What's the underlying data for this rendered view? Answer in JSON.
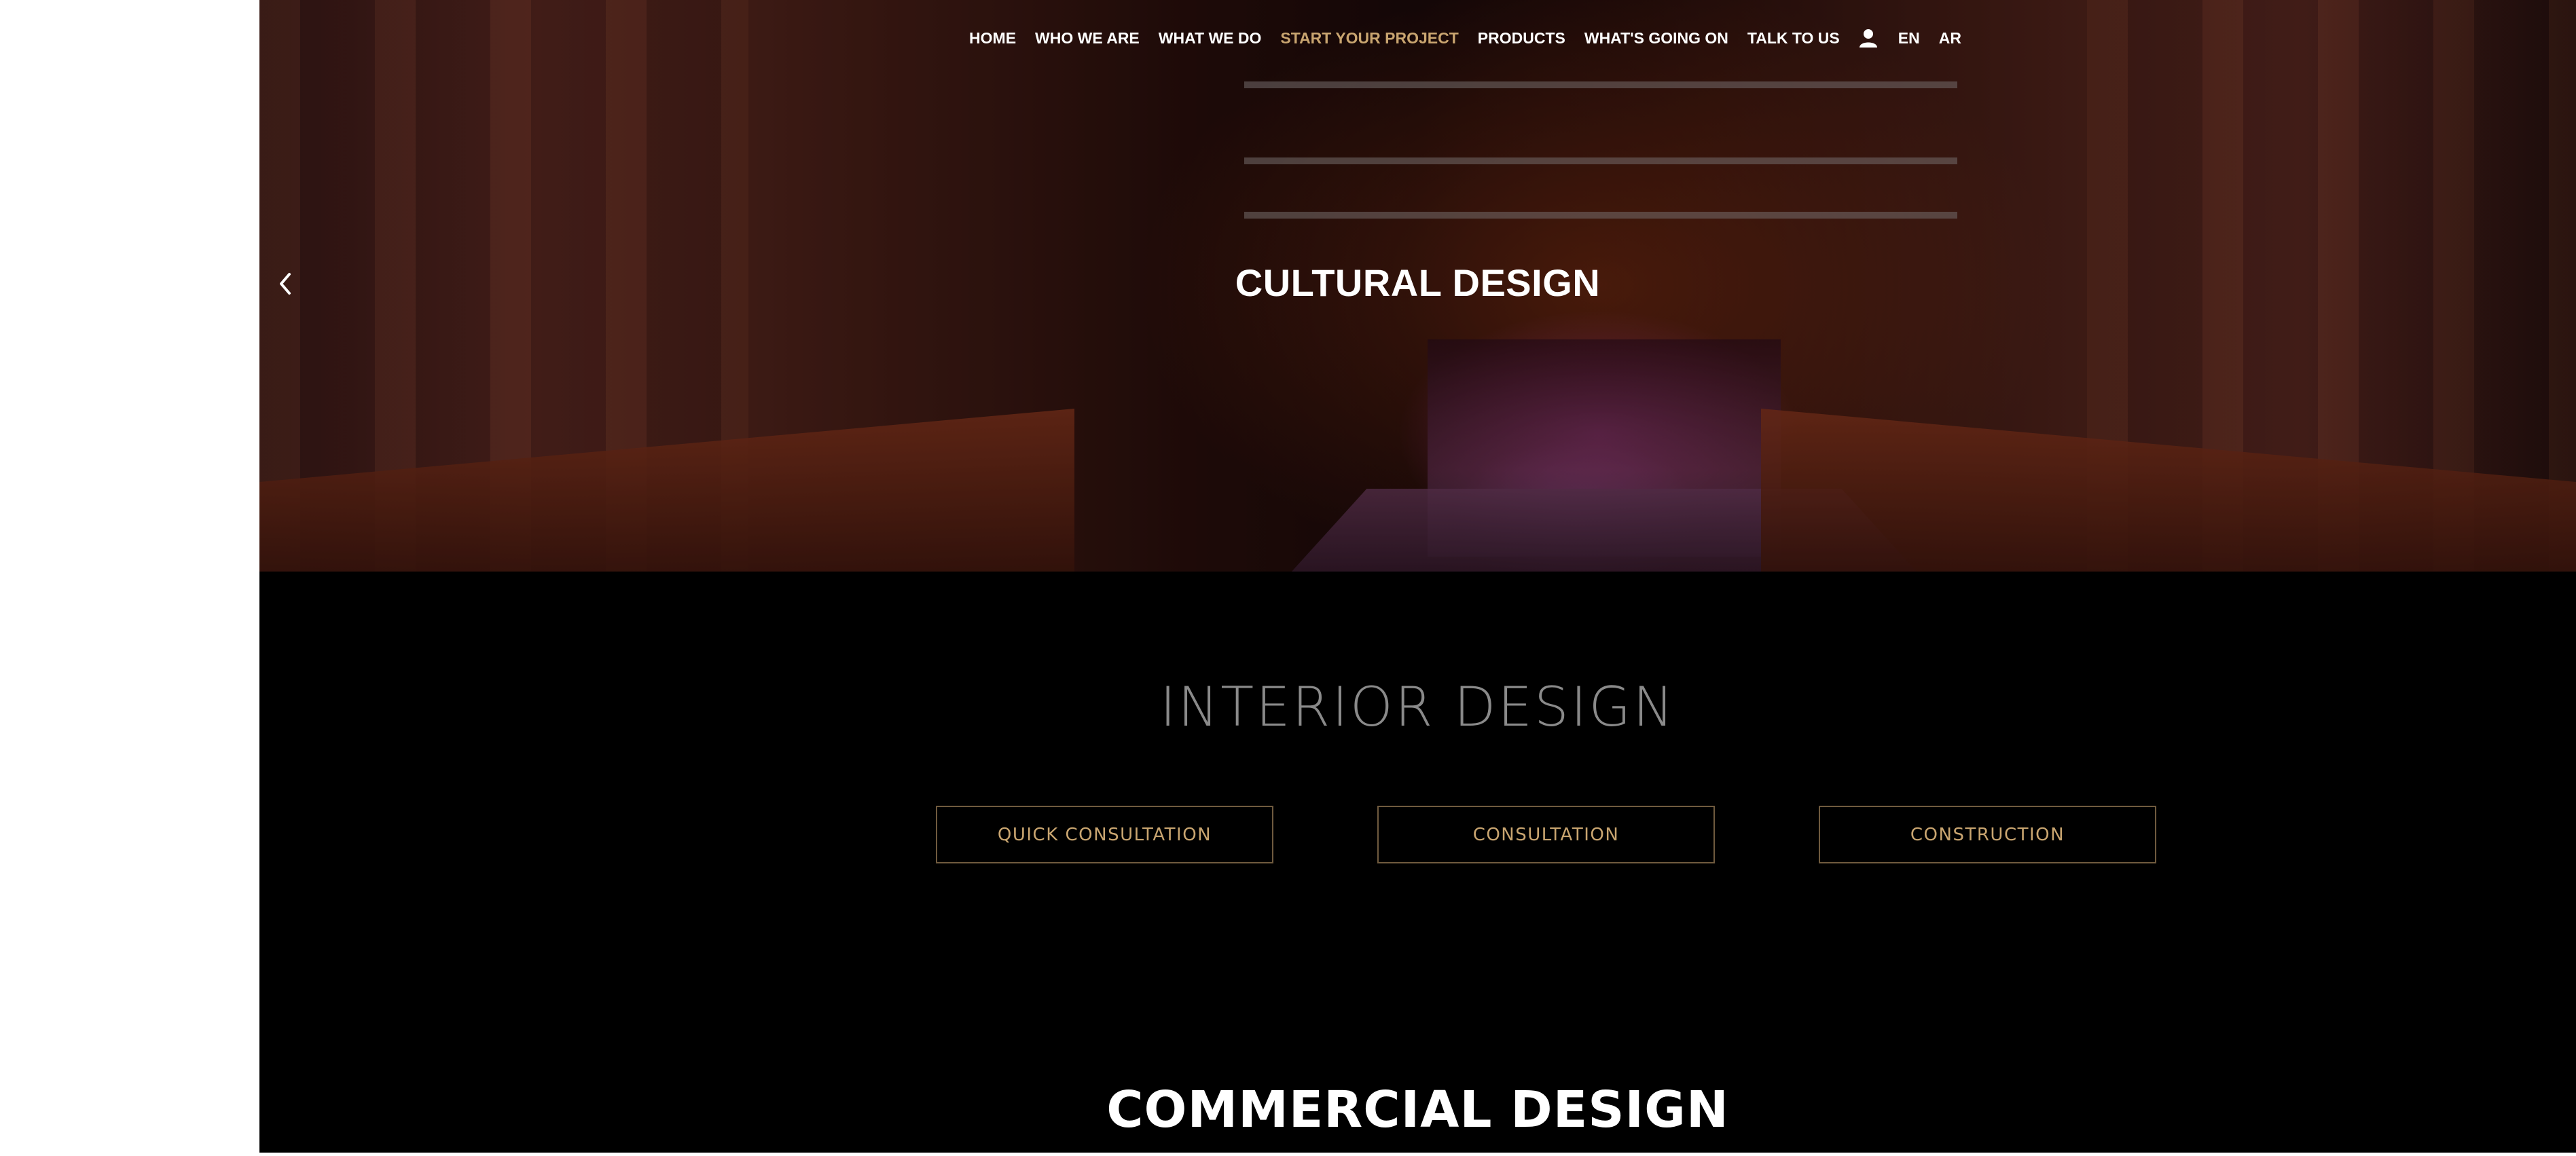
{
  "nav": {
    "items": [
      {
        "label": "HOME"
      },
      {
        "label": "WHO WE ARE"
      },
      {
        "label": "WHAT WE DO"
      },
      {
        "label": "START YOUR PROJECT",
        "active": true
      },
      {
        "label": "PRODUCTS"
      },
      {
        "label": "WHAT'S GOING ON"
      },
      {
        "label": "TALK TO US"
      }
    ],
    "user_icon": "user-icon",
    "languages": [
      "EN",
      "AR"
    ]
  },
  "hero": {
    "title": "CULTURAL DESIGN",
    "prev_icon": "chevron-left-icon"
  },
  "interior": {
    "title": "INTERIOR DESIGN",
    "buttons": [
      "QUICK CONSULTATION",
      "CONSULTATION",
      "CONSTRUCTION"
    ]
  },
  "commercial": {
    "title": "COMMERCIAL DESIGN"
  },
  "colors": {
    "accent": "#c9a570",
    "background": "#000000",
    "button_border": "#6f5a3e",
    "muted_title": "#8a8a8a"
  }
}
